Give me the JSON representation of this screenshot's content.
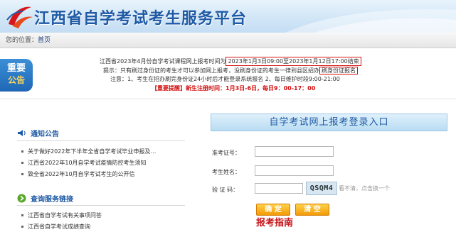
{
  "header": {
    "title": "江西省自学考试考生服务平台",
    "logo_icon": "red-swoosh-logo-icon"
  },
  "breadcrumb": {
    "prefix": "您的位置：",
    "current": "首页"
  },
  "notice": {
    "ribbon_line1": "重要",
    "ribbon_line2": "公告",
    "line1_prefix": "江西省2023年4月份自学考试课程网上报考时间为",
    "line1_highlight": "2023年1月3日09:00至2023年1月12日17:00结束",
    "line2_prefix": "提示：只有刷过身份证的考生才可以参加网上报考，没刷身份证的考生一律到县区招办",
    "line2_highlight": "刷身份证报名",
    "line3": "注意：1、考生在招办刷完身份证24小时后才能登录系统报名    2、每日维护时段9:00-21:00",
    "line4": "【重要提醒】新生注册时间：1月3日-6日，每日9：00-17：00",
    "accent_color": "#d20f0f"
  },
  "announcements": {
    "title": "通知公告",
    "icon": "speaker-icon",
    "items": [
      "关于做好2022年下半年全省自学考试毕业申报及…",
      "江西省2022年10月自学考试疫情防控考生须知",
      "致全省2022年10月自学考试考生的公开信"
    ]
  },
  "query": {
    "title": "查询服务链接",
    "icon": "green-arrow-circle-icon",
    "items": [
      "江西省自学考试有关事项问答",
      "江西省自学考试成绩查询"
    ]
  },
  "login": {
    "title": "自学考试网上报考登录入口",
    "exam_no_label": "准考证号：",
    "exam_no_value": "",
    "name_label": "考生姓名：",
    "name_value": "",
    "captcha_label": "验 证 码：",
    "captcha_value": "",
    "captcha_code": "QSQM4",
    "refresh_text": "看不清，点击换一个",
    "confirm_label": "确 定",
    "reset_label": "清 空",
    "guide_label": "报考指南"
  }
}
